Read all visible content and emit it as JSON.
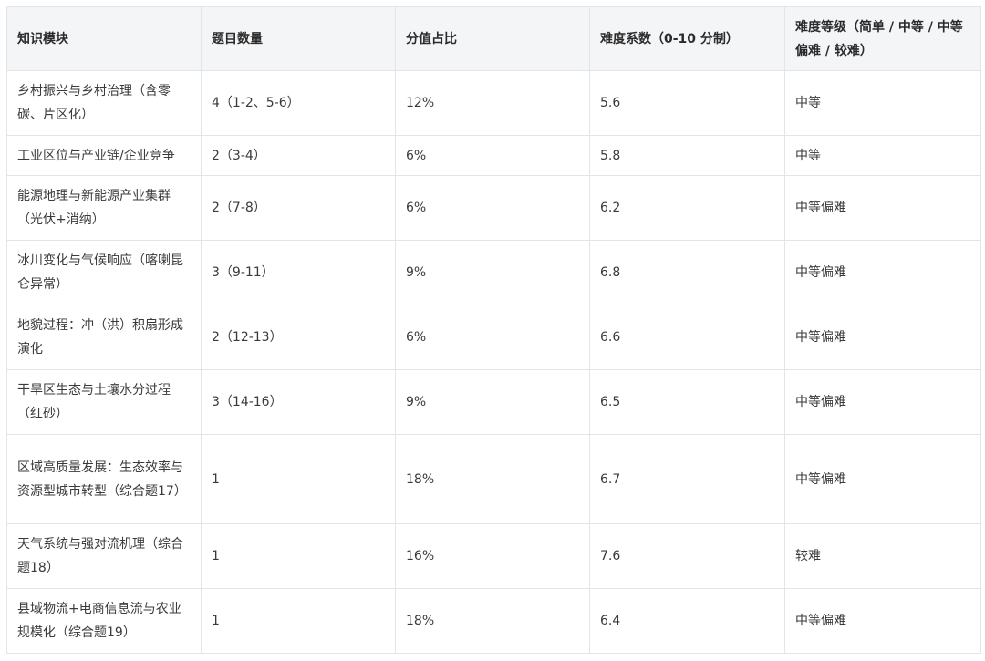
{
  "table": {
    "headers": [
      "知识模块",
      "题目数量",
      "分值占比",
      "难度系数（0-10 分制）",
      "难度等级（简单 / 中等 / 中等偏难 / 较难）"
    ],
    "rows": [
      [
        "乡村振兴与乡村治理（含零碳、片区化）",
        "4（1-2、5-6）",
        "12%",
        "5.6",
        "中等"
      ],
      [
        "工业区位与产业链/企业竞争",
        "2（3-4）",
        "6%",
        "5.8",
        "中等"
      ],
      [
        "能源地理与新能源产业集群（光伏+消纳）",
        "2（7-8）",
        "6%",
        "6.2",
        "中等偏难"
      ],
      [
        "冰川变化与气候响应（喀喇昆仑异常）",
        "3（9-11）",
        "9%",
        "6.8",
        "中等偏难"
      ],
      [
        "地貌过程：冲（洪）积扇形成演化",
        "2（12-13）",
        "6%",
        "6.6",
        "中等偏难"
      ],
      [
        "干旱区生态与土壤水分过程（红砂）",
        "3（14-16）",
        "9%",
        "6.5",
        "中等偏难"
      ],
      [
        "区域高质量发展：生态效率与资源型城市转型（综合题17）",
        "1",
        "18%",
        "6.7",
        "中等偏难"
      ],
      [
        "天气系统与强对流机理（综合题18）",
        "1",
        "16%",
        "7.6",
        "较难"
      ],
      [
        "县域物流+电商信息流与农业规模化（综合题19）",
        "1",
        "18%",
        "6.4",
        "中等偏难"
      ]
    ]
  }
}
